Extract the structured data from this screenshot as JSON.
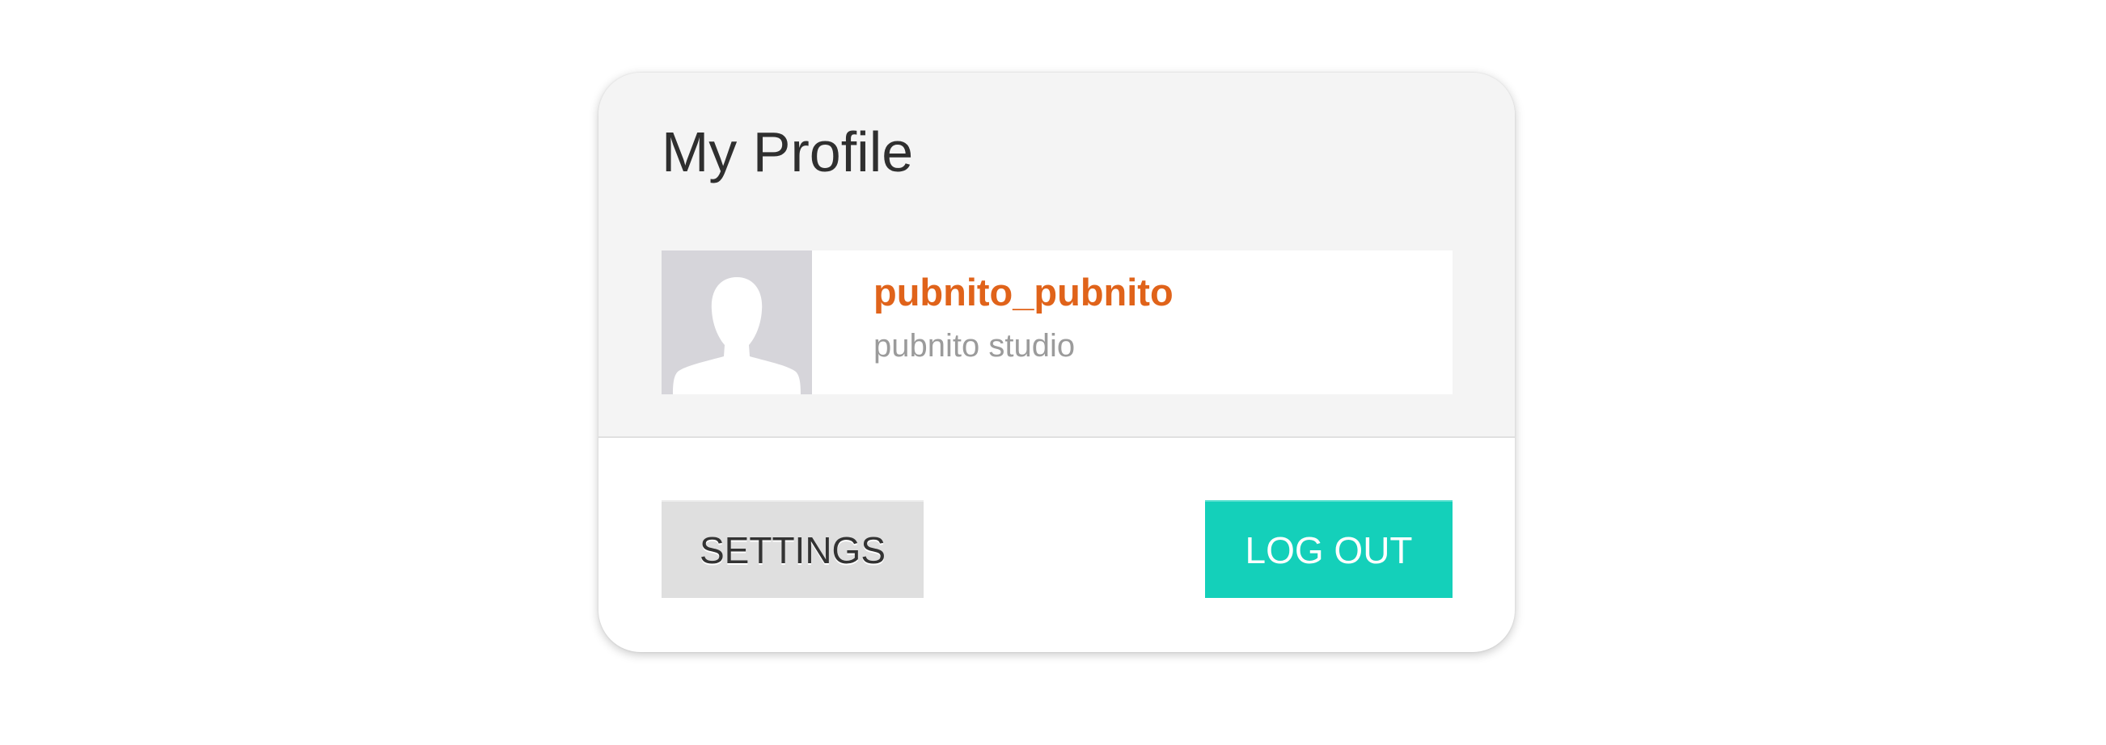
{
  "profile": {
    "title": "My Profile",
    "username": "pubnito_pubnito",
    "subtitle": "pubnito studio",
    "avatar_icon": "user-silhouette-icon"
  },
  "actions": {
    "settings_label": "SETTINGS",
    "logout_label": "LOG OUT"
  },
  "colors": {
    "username": "#e0631a",
    "logout_button": "#14d0ba",
    "settings_button": "#dfdfdf",
    "card_header": "#f4f4f4",
    "avatar_bg": "#d6d5da"
  }
}
